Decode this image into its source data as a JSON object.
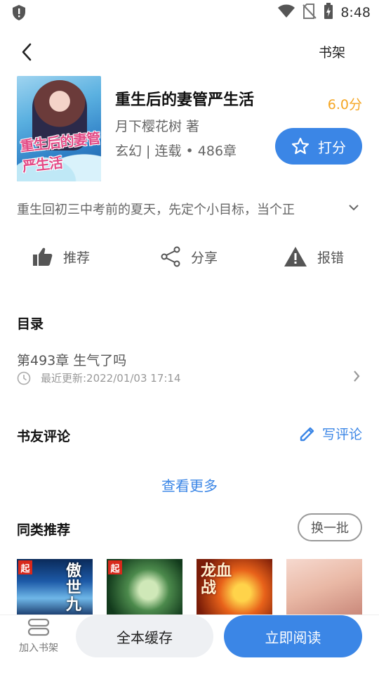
{
  "status_bar": {
    "time": "8:48"
  },
  "toolbar": {
    "shelf_label": "书架"
  },
  "book": {
    "cover_text": "重生后的妻管严生活",
    "title": "重生后的妻管严生活",
    "author": "月下樱花树 著",
    "meta": "玄幻 | 连载 • 486章",
    "score": "6.0分",
    "rate_label": "打分",
    "intro": "重生回初三中考前的夏天，先定个小目标，当个正"
  },
  "actions": {
    "recommend": "推荐",
    "share": "分享",
    "report": "报错"
  },
  "toc": {
    "title": "目录",
    "latest_chapter": "第493章 生气了吗",
    "last_update": "最近更新:2022/01/03 17:14"
  },
  "comments": {
    "title": "书友评论",
    "write_label": "写评论",
    "see_more": "查看更多"
  },
  "similar": {
    "title": "同类推荐",
    "refresh_label": "换一批",
    "covers": [
      {
        "badge": "起",
        "text": "傲世九"
      },
      {
        "badge": "起",
        "text": ""
      },
      {
        "badge": "",
        "text": "龙血战"
      },
      {
        "badge": "",
        "text": ""
      }
    ]
  },
  "bottom_bar": {
    "add_shelf": "加入书架",
    "cache_all": "全本缓存",
    "read_now": "立即阅读"
  },
  "colors": {
    "accent": "#3b86e6",
    "score": "#f5a623"
  }
}
